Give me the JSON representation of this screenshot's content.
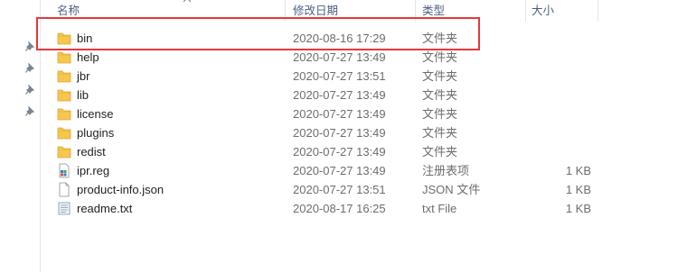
{
  "columns": {
    "name": "名称",
    "date": "修改日期",
    "type": "类型",
    "size": "大小"
  },
  "files": [
    {
      "name": "bin",
      "date": "2020-08-16 17:29",
      "type": "文件夹",
      "size": "",
      "icon": "folder-icon"
    },
    {
      "name": "help",
      "date": "2020-07-27 13:49",
      "type": "文件夹",
      "size": "",
      "icon": "folder-icon"
    },
    {
      "name": "jbr",
      "date": "2020-07-27 13:51",
      "type": "文件夹",
      "size": "",
      "icon": "folder-icon"
    },
    {
      "name": "lib",
      "date": "2020-07-27 13:49",
      "type": "文件夹",
      "size": "",
      "icon": "folder-icon"
    },
    {
      "name": "license",
      "date": "2020-07-27 13:49",
      "type": "文件夹",
      "size": "",
      "icon": "folder-icon"
    },
    {
      "name": "plugins",
      "date": "2020-07-27 13:49",
      "type": "文件夹",
      "size": "",
      "icon": "folder-icon"
    },
    {
      "name": "redist",
      "date": "2020-07-27 13:49",
      "type": "文件夹",
      "size": "",
      "icon": "folder-icon"
    },
    {
      "name": "ipr.reg",
      "date": "2020-07-27 13:49",
      "type": "注册表项",
      "size": "1 KB",
      "icon": "registry-file-icon"
    },
    {
      "name": "product-info.json",
      "date": "2020-07-27 13:51",
      "type": "JSON 文件",
      "size": "1 KB",
      "icon": "blank-file-icon"
    },
    {
      "name": "readme.txt",
      "date": "2020-08-17 16:25",
      "type": "txt File",
      "size": "1 KB",
      "icon": "text-file-icon"
    }
  ],
  "colors": {
    "header_text": "#4d6182",
    "folder": "#f6c64f",
    "highlight": "#e5383b"
  }
}
